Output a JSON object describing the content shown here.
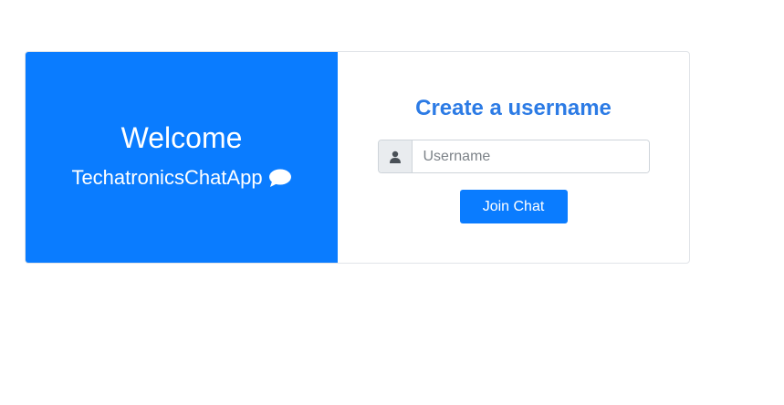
{
  "welcome_panel": {
    "heading": "Welcome",
    "app_name": "TechatronicsChatApp",
    "icon": "chat-bubble-icon"
  },
  "form": {
    "title": "Create a username",
    "input_icon": "user-icon",
    "username_value": "",
    "username_placeholder": "Username",
    "submit_label": "Join Chat"
  },
  "colors": {
    "brand_blue": "#0a7cff",
    "title_blue": "#2c7be5",
    "addon_gray": "#e9ecef",
    "border_gray": "#ced4da"
  }
}
